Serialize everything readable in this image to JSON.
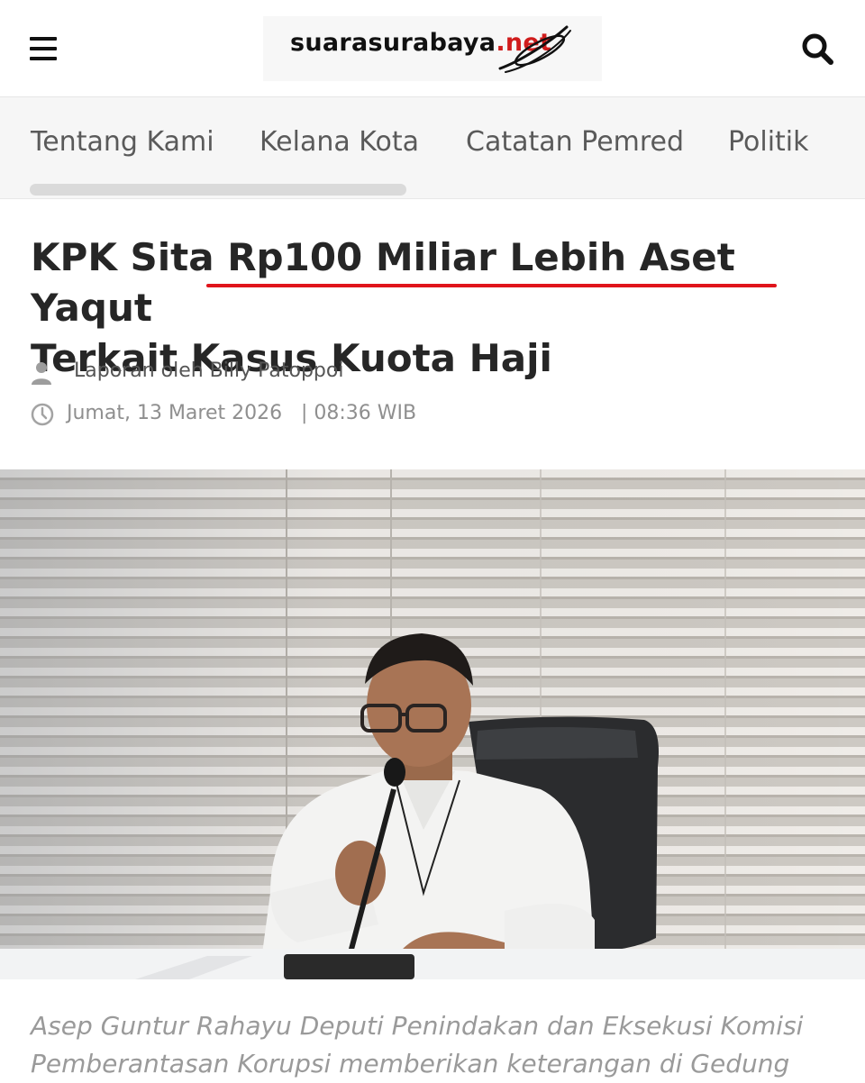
{
  "header": {
    "logo": {
      "name": "suarasurabaya",
      "tld": ".net"
    },
    "menu_icon": "hamburger-menu-icon",
    "search_icon": "search-icon"
  },
  "nav": {
    "items": [
      "Tentang Kami",
      "Kelana Kota",
      "Catatan Pemred",
      "Politik"
    ]
  },
  "article": {
    "title_part1": "KPK Sita ",
    "title_highlight": "Rp100 Miliar Lebih Aset Yaqut",
    "title_part2": "Terkait Kasus Kuota Haji",
    "highlight_color": "#e0141b",
    "author": "Laporan oleh Billy Patoppoi",
    "date": "Jumat, 13 Maret 2026",
    "time": "| 08:36 WIB",
    "caption": "Asep Guntur Rahayu Deputi Penindakan dan Eksekusi Komisi Pemberantasan Korupsi memberikan keterangan di Gedung"
  }
}
